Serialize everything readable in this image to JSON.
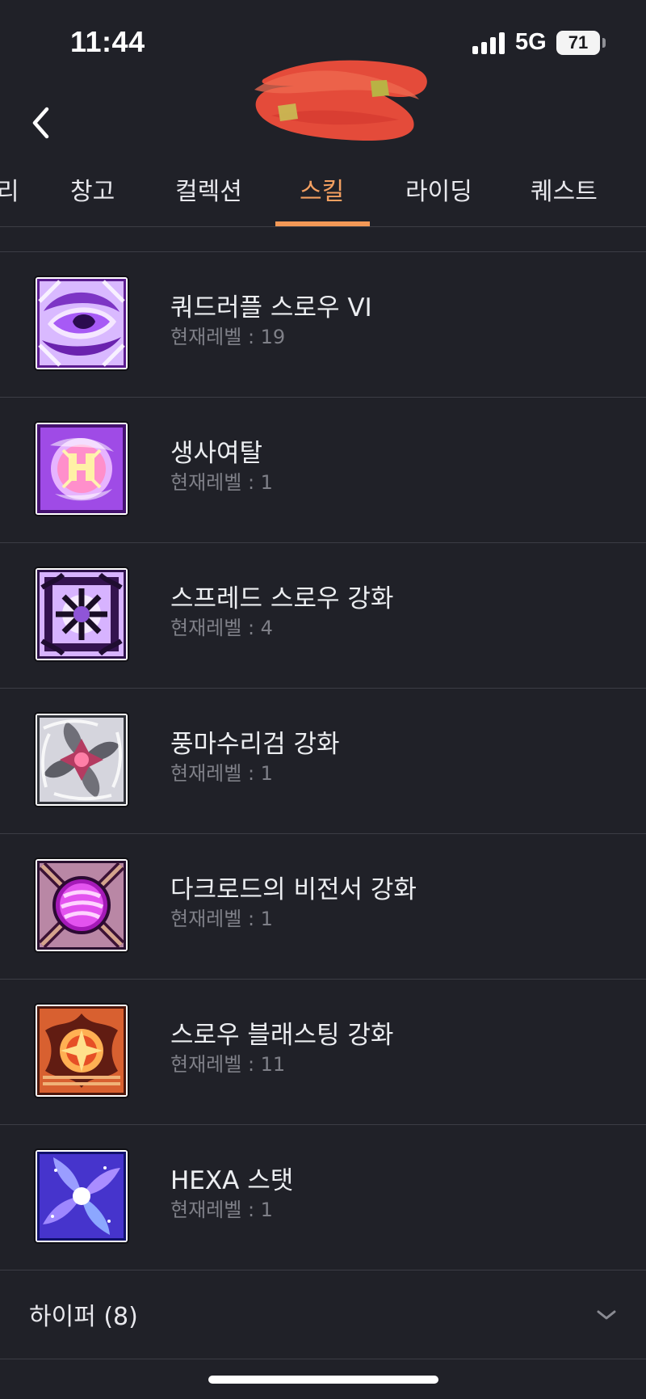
{
  "status_bar": {
    "time": "11:44",
    "network": "5G",
    "battery": "71"
  },
  "header": {
    "back_icon": "chevron-left-icon",
    "title_redacted": true,
    "redaction_color": "#e44b3a"
  },
  "tabs": [
    {
      "label": "리"
    },
    {
      "label": "창고"
    },
    {
      "label": "컬렉션"
    },
    {
      "label": "스킬",
      "active": true
    },
    {
      "label": "라이딩"
    },
    {
      "label": "퀘스트"
    }
  ],
  "skills": [
    {
      "name": "쿼드러플 스로우 VI",
      "level": "현재레벨 : 19",
      "icon": "purple-swirl-skill-icon"
    },
    {
      "name": "생사여탈",
      "level": "현재레벨 : 1",
      "icon": "life-death-skill-icon"
    },
    {
      "name": "스프레드 스로우 강화",
      "level": "현재레벨 : 4",
      "icon": "snowflake-seal-skill-icon"
    },
    {
      "name": "풍마수리검 강화",
      "level": "현재레벨 : 1",
      "icon": "windmill-shuriken-skill-icon"
    },
    {
      "name": "다크로드의 비전서 강화",
      "level": "현재레벨 : 1",
      "icon": "dark-orb-skill-icon"
    },
    {
      "name": "스로우 블래스팅 강화",
      "level": "현재레벨 : 11",
      "icon": "fire-emblem-skill-icon"
    },
    {
      "name": "HEXA 스탯",
      "level": "현재레벨 : 1",
      "icon": "hexa-stat-galaxy-icon"
    }
  ],
  "group": {
    "label": "하이퍼 (8)",
    "expand_icon": "chevron-down-icon"
  },
  "colors": {
    "background": "#202128",
    "accent": "#f39856",
    "divider": "#3c3d45",
    "secondary_text": "#7f8088"
  }
}
